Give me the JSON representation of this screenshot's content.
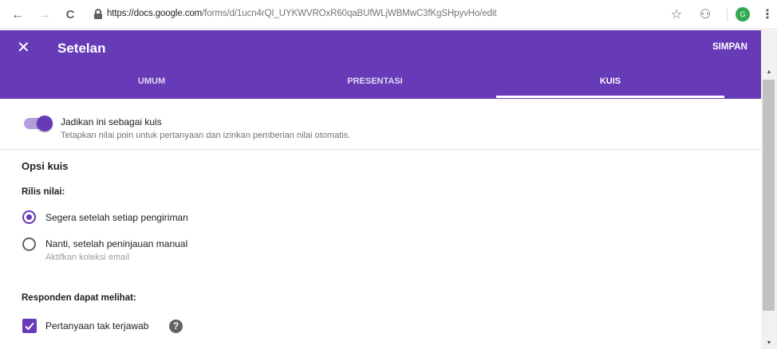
{
  "browser": {
    "back_icon": "←",
    "forward_icon": "→",
    "reload_icon": "C",
    "url_domain": "https://docs.google.com",
    "url_path": "/forms/d/1ucn4rQI_UYKWVROxR60qaBUfWLjWBMwC3fKgSHpyvHo/edit",
    "star_icon": "☆",
    "extension_icon": "⚇",
    "profile_initial": "G",
    "menu_icon": "⋮"
  },
  "header": {
    "close_icon": "✕",
    "title": "Setelan",
    "save_label": "SIMPAN",
    "tabs": [
      {
        "label": "UMUM"
      },
      {
        "label": "PRESENTASI"
      },
      {
        "label": "KUIS"
      }
    ],
    "active_tab": "KUIS",
    "accent_color": "#673ab7"
  },
  "quiz_toggle": {
    "enabled": true,
    "label": "Jadikan ini sebagai kuis",
    "description": "Tetapkan nilai poin untuk pertanyaan dan izinkan pemberian nilai otomatis."
  },
  "quiz_options": {
    "title": "Opsi kuis",
    "release_grade": {
      "label": "Rilis nilai:",
      "options": [
        {
          "label": "Segera setelah setiap pengiriman",
          "checked": true
        },
        {
          "label": "Nanti, setelah peninjauan manual",
          "sublabel": "Aktifkan koleksi email",
          "checked": false
        }
      ]
    },
    "respondents_can_see": {
      "label": "Responden dapat melihat:",
      "items": [
        {
          "label": "Pertanyaan tak terjawab",
          "checked": true,
          "help_icon": "?"
        }
      ]
    }
  }
}
